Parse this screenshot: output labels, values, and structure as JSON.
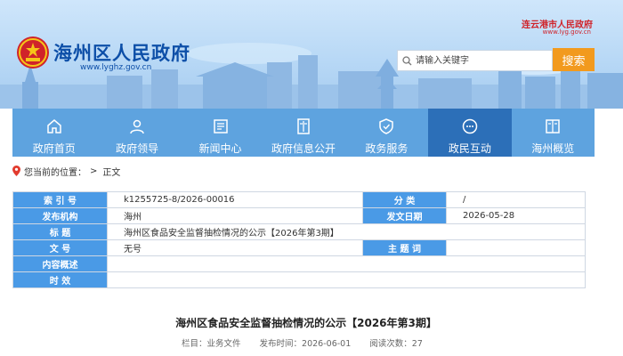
{
  "header": {
    "site_title": "海州区人民政府",
    "site_url": "www.lyghz.gov.cn",
    "city_link": "连云港市人民政府",
    "city_url": "www.lyg.gov.cn",
    "search_placeholder": "请输入关键字",
    "search_button": "搜索"
  },
  "nav": {
    "items": [
      {
        "label": "政府首页",
        "icon": "home-icon"
      },
      {
        "label": "政府领导",
        "icon": "person-icon"
      },
      {
        "label": "新闻中心",
        "icon": "news-icon"
      },
      {
        "label": "政府信息公开",
        "icon": "document-icon"
      },
      {
        "label": "政务服务",
        "icon": "shield-icon"
      },
      {
        "label": "政民互动",
        "icon": "chat-icon"
      },
      {
        "label": "海州概览",
        "icon": "book-icon"
      }
    ],
    "active_index": 5
  },
  "breadcrumb": {
    "prefix": "您当前的位置：",
    "current": "正文"
  },
  "info": {
    "rows": [
      [
        {
          "l": "索 引 号",
          "v": "k1255725-8/2026-00016"
        },
        {
          "l": "分 类",
          "v": "/"
        }
      ],
      [
        {
          "l": "发布机构",
          "v": "海州"
        },
        {
          "l": "发文日期",
          "v": "2026-05-28"
        }
      ],
      [
        {
          "l": "标 题",
          "v": "海州区食品安全监督抽检情况的公示【2026年第3期】"
        }
      ],
      [
        {
          "l": "文 号",
          "v": "无号"
        },
        {
          "l": "主 题 词",
          "v": ""
        }
      ],
      [
        {
          "l": "内容概述",
          "v": ""
        }
      ],
      [
        {
          "l": "时 效",
          "v": ""
        }
      ]
    ]
  },
  "article": {
    "title": "海州区食品安全监督抽检情况的公示【2026年第3期】",
    "column": "栏目：业务文件",
    "published": "发布时间：2026-06-01",
    "reads": "阅读次数：27"
  },
  "colors": {
    "brand_blue": "#0d4fa8",
    "nav_blue": "#509bdc",
    "nav_active": "#2c6fb8",
    "label_blue": "#4a9ae6",
    "search_orange": "#f29a1e",
    "city_red": "#d0232a"
  }
}
